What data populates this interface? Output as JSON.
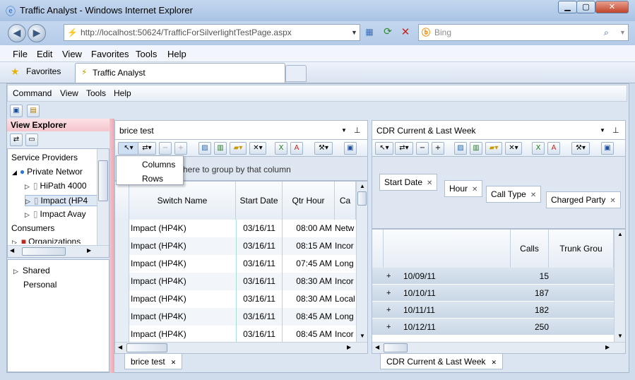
{
  "browser": {
    "title": "Traffic Analyst - Windows Internet Explorer",
    "address": "http://localhost:50624/TrafficForSilverlightTestPage.aspx",
    "search_placeholder": "Bing",
    "menu": [
      "File",
      "Edit",
      "View",
      "Favorites",
      "Tools",
      "Help"
    ],
    "favorites_label": "Favorites",
    "tab_title": "Traffic Analyst"
  },
  "app": {
    "menu": [
      "Command",
      "View",
      "Tools",
      "Help"
    ],
    "left_panel": {
      "title": "View Explorer",
      "tree": [
        {
          "label": "Service Providers",
          "level": 0
        },
        {
          "label": "Private Networ",
          "level": 1
        },
        {
          "label": "HiPath 4000",
          "level": 2
        },
        {
          "label": "Impact (HP4",
          "level": 2
        },
        {
          "label": "Impact Avay",
          "level": 2
        },
        {
          "label": "Consumers",
          "level": 0
        },
        {
          "label": "Organizations",
          "level": 1
        }
      ],
      "tree2": [
        {
          "label": "Shared",
          "level": 0
        },
        {
          "label": "Personal",
          "level": 0
        }
      ]
    },
    "panel1": {
      "title": "brice test",
      "group_hint": "here to group by that column",
      "popup_items": [
        "Columns",
        "Rows"
      ],
      "columns": [
        "Switch Name",
        "Start Date",
        "Qtr Hour",
        "Ca"
      ],
      "rows": [
        [
          "Impact (HP4K)",
          "03/16/11",
          "08:00 AM",
          "Netw"
        ],
        [
          "Impact (HP4K)",
          "03/16/11",
          "08:15 AM",
          "Incor"
        ],
        [
          "Impact (HP4K)",
          "03/16/11",
          "07:45 AM",
          "Long"
        ],
        [
          "Impact (HP4K)",
          "03/16/11",
          "08:30 AM",
          "Incor"
        ],
        [
          "Impact (HP4K)",
          "03/16/11",
          "08:30 AM",
          "Local"
        ],
        [
          "Impact (HP4K)",
          "03/16/11",
          "08:45 AM",
          "Long"
        ],
        [
          "Impact (HP4K)",
          "03/16/11",
          "08:45 AM",
          "Incor"
        ]
      ],
      "tab": "brice test"
    },
    "panel2": {
      "title": "CDR Current & Last Week",
      "group_chips": [
        "Start Date",
        "Hour",
        "Call Type",
        "Charged Party"
      ],
      "columns": [
        "Calls",
        "Trunk Grou"
      ],
      "rows": [
        [
          "10/09/11",
          "15"
        ],
        [
          "10/10/11",
          "187"
        ],
        [
          "10/11/11",
          "182"
        ],
        [
          "10/12/11",
          "250"
        ]
      ],
      "tab": "CDR Current & Last Week"
    }
  },
  "colors": {
    "accent_pink": "#f4c5cc",
    "grid_alt": "#e6edf5"
  }
}
